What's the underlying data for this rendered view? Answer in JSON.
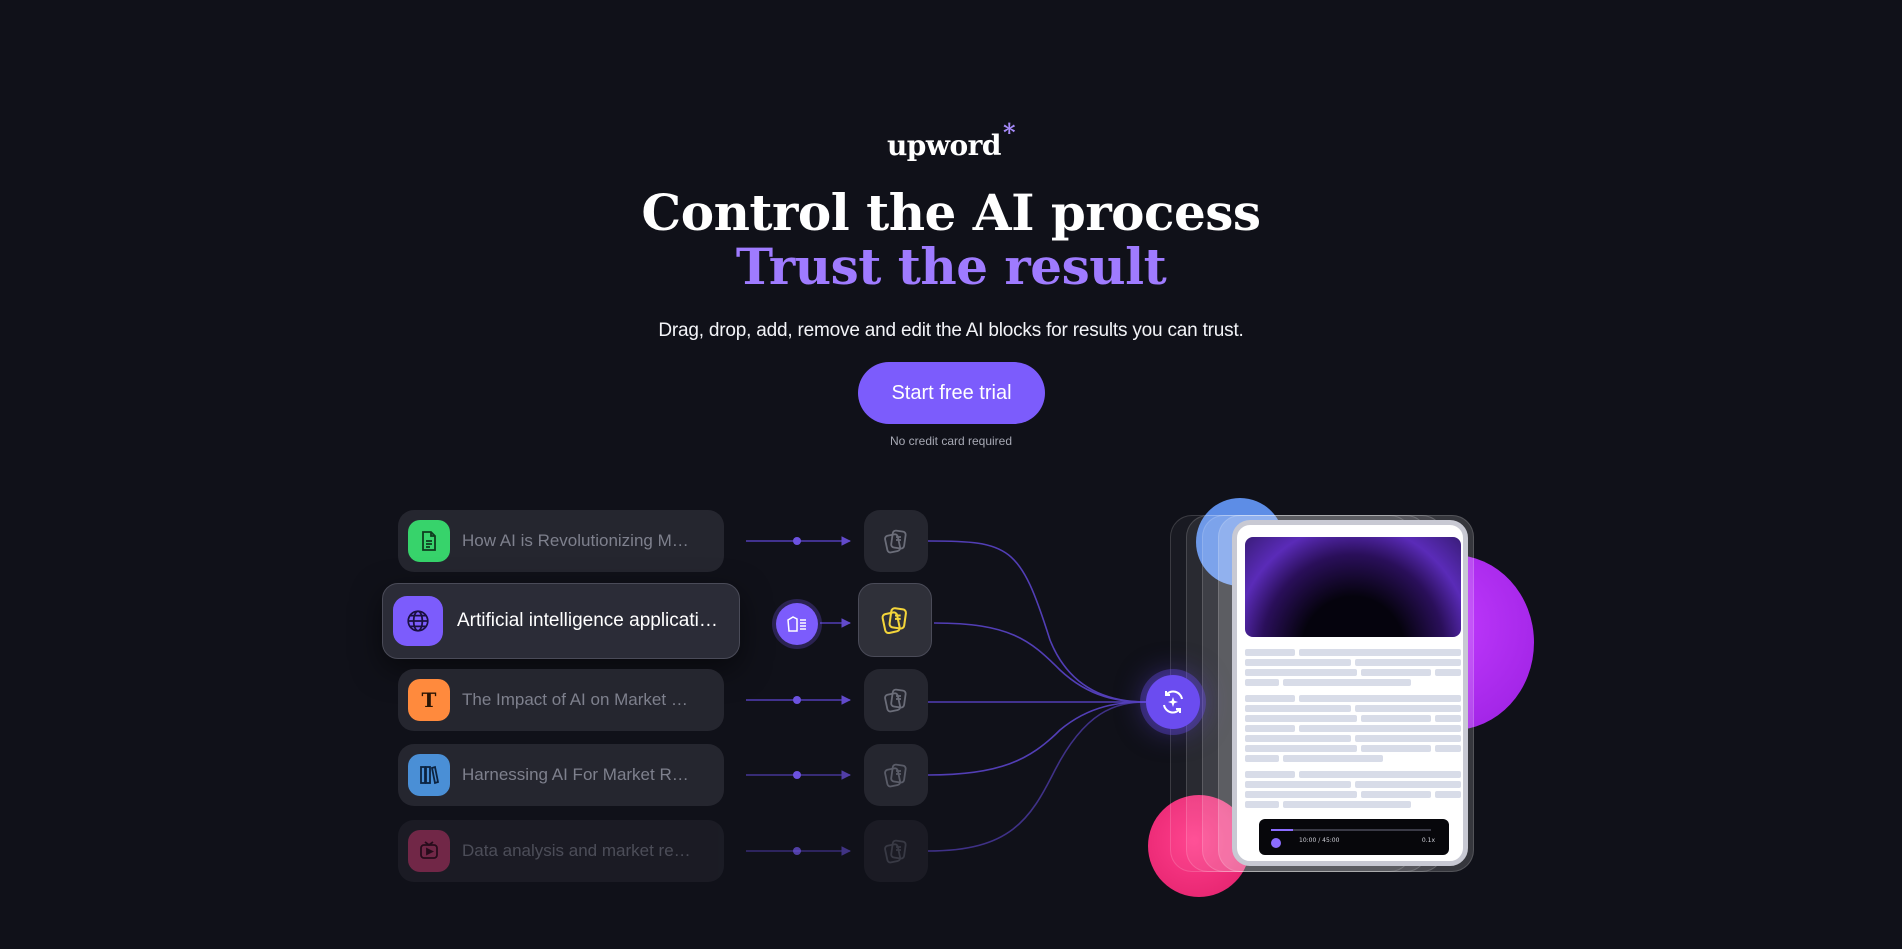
{
  "brand": {
    "name": "upword",
    "mark": "*"
  },
  "hero": {
    "headline": "Control the AI process",
    "headline_accent": "Trust the result",
    "subtitle": "Drag, drop, add, remove and edit the AI blocks for results you can trust.",
    "cta_label": "Start free trial",
    "note": "No credit card required"
  },
  "sources": [
    {
      "title": "How AI is Revolutionizing Market Research",
      "icon": "document-icon",
      "color": "#37d36b"
    },
    {
      "title": "Artificial intelligence applications in market research",
      "icon": "globe-icon",
      "color": "#7c5cfc",
      "active": true
    },
    {
      "title": "The Impact of AI on Market Research",
      "icon": "text-t-icon",
      "color": "#ff8a3d"
    },
    {
      "title": "Harnessing AI For Market Research",
      "icon": "books-icon",
      "color": "#4a8fd6"
    },
    {
      "title": "Data analysis and market research",
      "icon": "video-icon",
      "color": "#c23b6e"
    }
  ],
  "player": {
    "time": "10:00 / 45:00",
    "speed": "0.1x"
  },
  "colors": {
    "accent": "#7c5cfc",
    "accent_light": "#9f7bff",
    "background": "#101119"
  }
}
